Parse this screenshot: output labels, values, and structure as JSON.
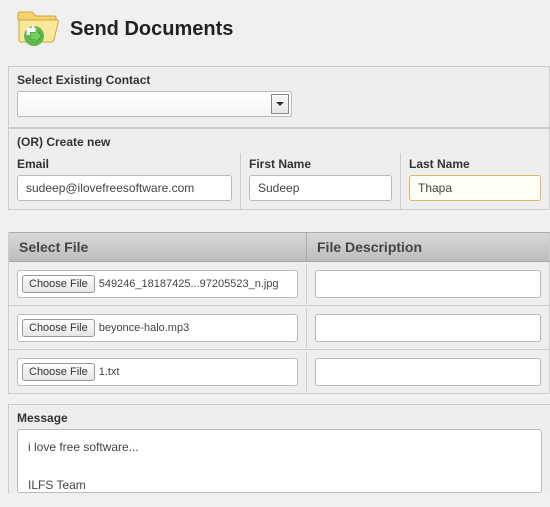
{
  "header": {
    "title": "Send Documents"
  },
  "contact": {
    "select_label": "Select Existing Contact",
    "dropdown_value": "",
    "or_label": "(OR) Create new",
    "email_label": "Email",
    "email_value": "sudeep@ilovefreesoftware.com",
    "first_label": "First Name",
    "first_value": "Sudeep",
    "last_label": "Last Name",
    "last_value": "Thapa"
  },
  "files": {
    "col_select": "Select File",
    "col_desc": "File Description",
    "choose_label": "Choose File",
    "rows": [
      {
        "name": "549246_18187425...97205523_n.jpg",
        "desc": ""
      },
      {
        "name": "beyonce-halo.mp3",
        "desc": ""
      },
      {
        "name": "1.txt",
        "desc": ""
      }
    ]
  },
  "message": {
    "label": "Message",
    "body": "i love free software...\n\nILFS Team"
  }
}
